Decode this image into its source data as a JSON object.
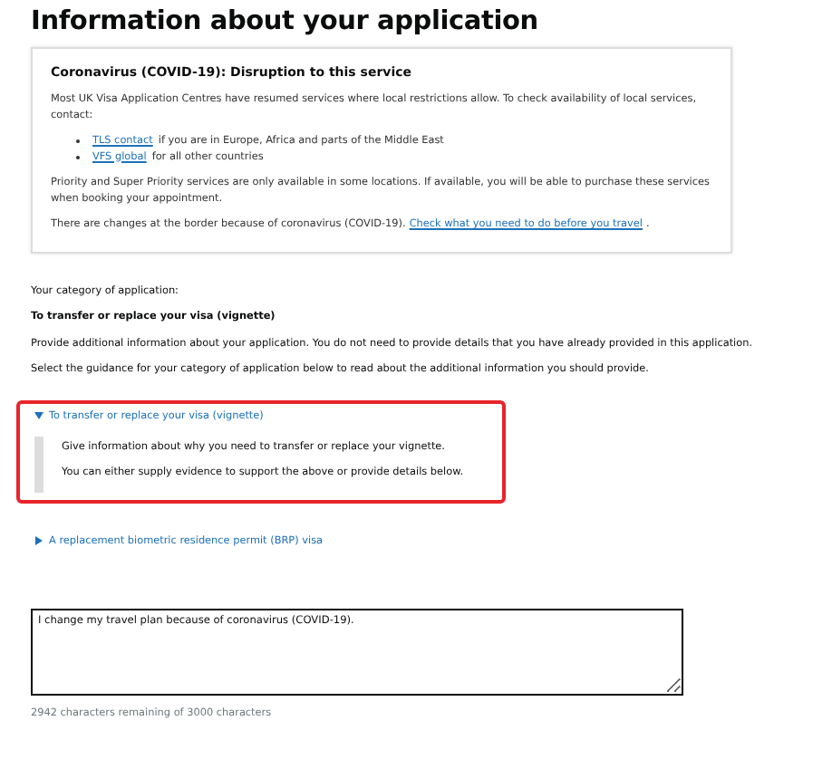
{
  "heading": "Information about your application",
  "notice": {
    "title": "Coronavirus (COVID-19): Disruption to this service",
    "intro": "Most UK Visa Application Centres have resumed services where local restrictions allow. To check availability of local services, contact:",
    "list": [
      {
        "link": "TLS contact",
        "text": "if you are in Europe, Africa and parts of the Middle East"
      },
      {
        "link": "VFS global",
        "text": "for all other countries"
      }
    ],
    "priority": "Priority and Super Priority services are only available in some locations. If available, you will be able to purchase these services when booking your appointment.",
    "border_text": "There are changes at the border because of coronavirus (COVID-19).",
    "border_link": "Check what you need to do before you travel",
    "border_end": "."
  },
  "category_label": "Your category of application:",
  "category": "To transfer or replace your visa (vignette)",
  "instructions": [
    "Provide additional information about your application. You do not need to provide details that you have already provided in this application.",
    "Select the guidance for your category of application below to read about the additional information you should provide."
  ],
  "details": [
    {
      "summary": "To transfer or replace your visa (vignette)",
      "expanded": true,
      "highlighted": true,
      "paragraphs": [
        "Give information about why you need to transfer or replace your vignette.",
        "You can either supply evidence to support the above or provide details below."
      ]
    },
    {
      "summary": "A replacement biometric residence permit (BRP) visa",
      "expanded": false,
      "highlighted": false
    }
  ],
  "textarea": {
    "value": "I change my travel plan because of coronavirus (COVID-19)."
  },
  "char_count": "2942 characters remaining of 3000 characters"
}
